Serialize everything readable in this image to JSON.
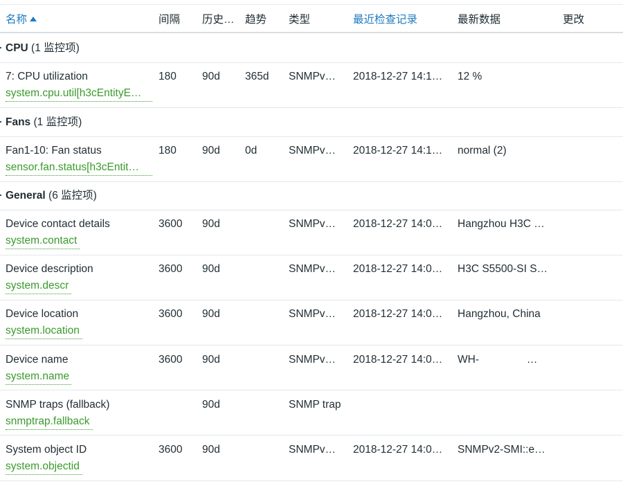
{
  "header": {
    "name": "名称",
    "interval": "间隔",
    "history": "历史…",
    "trends": "趋势",
    "type": "类型",
    "lastcheck": "最近检查记录",
    "lastvalue": "最新数据",
    "change": "更改"
  },
  "groups": [
    {
      "name": "CPU",
      "count": "(1 监控项)"
    },
    {
      "name": "Fans",
      "count": "(1 监控项)"
    },
    {
      "name": "General",
      "count": "(6 监控项)"
    }
  ],
  "rows": [
    {
      "name": "7: CPU utilization",
      "key": "system.cpu.util[h3cEntityE…",
      "interval": "180",
      "history": "90d",
      "trends": "365d",
      "type": "SNMPv…",
      "lastcheck": "2018-12-27 14:1…",
      "lastvalue": "12 %"
    },
    {
      "name": "Fan1-10: Fan status",
      "key": "sensor.fan.status[h3cEntit…",
      "interval": "180",
      "history": "90d",
      "trends": "0d",
      "type": "SNMPv…",
      "lastcheck": "2018-12-27 14:1…",
      "lastvalue": "normal (2)"
    },
    {
      "name": "Device contact details",
      "key": "system.contact",
      "interval": "3600",
      "history": "90d",
      "trends": "",
      "type": "SNMPv…",
      "lastcheck": "2018-12-27 14:0…",
      "lastvalue": "Hangzhou H3C …"
    },
    {
      "name": "Device description",
      "key": "system.descr",
      "interval": "3600",
      "history": "90d",
      "trends": "",
      "type": "SNMPv…",
      "lastcheck": "2018-12-27 14:0…",
      "lastvalue": "H3C S5500-SI S…"
    },
    {
      "name": "Device location",
      "key": "system.location",
      "interval": "3600",
      "history": "90d",
      "trends": "",
      "type": "SNMPv…",
      "lastcheck": "2018-12-27 14:0…",
      "lastvalue": "Hangzhou, China"
    },
    {
      "name": "Device name",
      "key": "system.name",
      "interval": "3600",
      "history": "90d",
      "trends": "",
      "type": "SNMPv…",
      "lastcheck": "2018-12-27 14:0…",
      "lastvalue": "WH-                …"
    },
    {
      "name": "SNMP traps (fallback)",
      "key": "snmptrap.fallback",
      "interval": "",
      "history": "90d",
      "trends": "",
      "type": "SNMP trap",
      "lastcheck": "",
      "lastvalue": ""
    },
    {
      "name": "System object ID",
      "key": "system.objectid",
      "interval": "3600",
      "history": "90d",
      "trends": "",
      "type": "SNMPv…",
      "lastcheck": "2018-12-27 14:0…",
      "lastvalue": "SNMPv2-SMI::e…"
    }
  ]
}
